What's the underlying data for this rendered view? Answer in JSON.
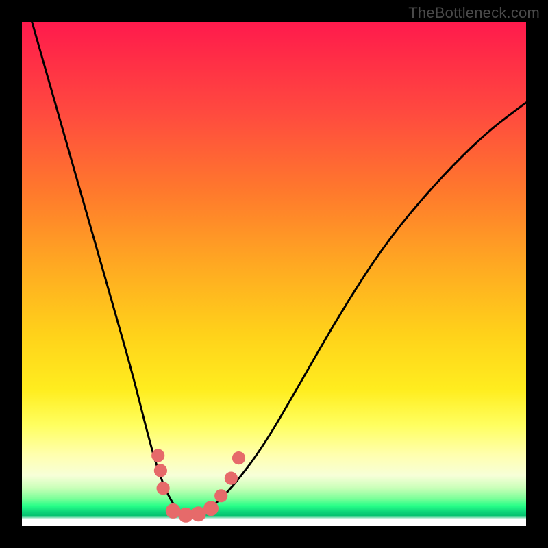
{
  "watermark": "TheBottleneck.com",
  "chart_data": {
    "type": "line",
    "title": "",
    "xlabel": "",
    "ylabel": "",
    "xlim": [
      0,
      100
    ],
    "ylim": [
      0,
      100
    ],
    "grid": false,
    "legend": false,
    "series": [
      {
        "name": "bottleneck-curve",
        "x": [
          2,
          6,
          10,
          14,
          18,
          22,
          25,
          27,
          29,
          31,
          33,
          35,
          38,
          42,
          48,
          55,
          63,
          72,
          82,
          92,
          100
        ],
        "y": [
          100,
          86,
          72,
          58,
          44,
          30,
          18,
          11,
          6,
          3,
          2,
          2,
          4,
          8,
          16,
          28,
          42,
          56,
          68,
          78,
          84
        ]
      }
    ],
    "markers": [
      {
        "name": "dot-left-upper",
        "x": 27.0,
        "y": 14.0,
        "r": 1.3
      },
      {
        "name": "dot-left-mid",
        "x": 27.5,
        "y": 11.0,
        "r": 1.3
      },
      {
        "name": "dot-left-lower",
        "x": 28.0,
        "y": 7.5,
        "r": 1.3
      },
      {
        "name": "dot-bottom-1",
        "x": 30.0,
        "y": 3.0,
        "r": 1.5
      },
      {
        "name": "dot-bottom-2",
        "x": 32.5,
        "y": 2.2,
        "r": 1.5
      },
      {
        "name": "dot-bottom-3",
        "x": 35.0,
        "y": 2.4,
        "r": 1.5
      },
      {
        "name": "dot-bottom-4",
        "x": 37.5,
        "y": 3.5,
        "r": 1.5
      },
      {
        "name": "dot-right-lower",
        "x": 39.5,
        "y": 6.0,
        "r": 1.3
      },
      {
        "name": "dot-right-mid",
        "x": 41.5,
        "y": 9.5,
        "r": 1.3
      },
      {
        "name": "dot-right-upper",
        "x": 43.0,
        "y": 13.5,
        "r": 1.3
      }
    ],
    "colors": {
      "curve": "#000000",
      "marker": "#e66a6a"
    }
  }
}
